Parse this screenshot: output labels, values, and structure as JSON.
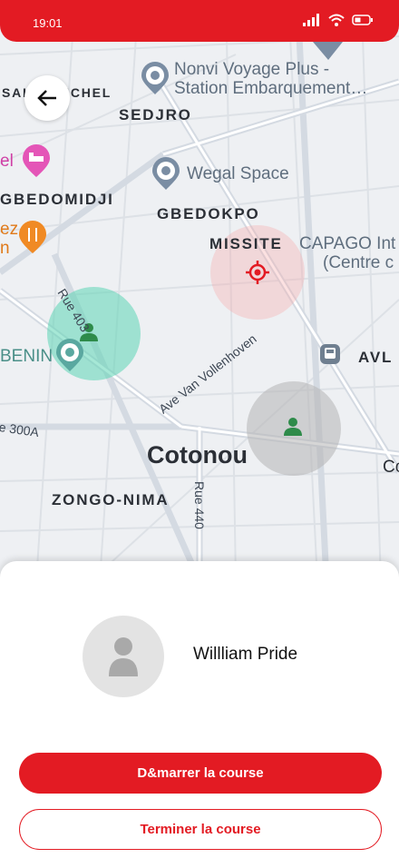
{
  "status_bar": {
    "time": "19:01"
  },
  "map": {
    "districts": [
      "SAINT-MICHEL",
      "SEDJRO",
      "GBEDOMIDJI",
      "GBEDOKPO",
      "MISSITE",
      "ZONGO-NIMA",
      "AVL"
    ],
    "pois": {
      "nonvi_line1": "Nonvi Voyage Plus -",
      "nonvi_line2": "Station Embarquement…",
      "wegal": "Wegal Space",
      "capago_line1": "CAPAGO Int",
      "capago_line2": "(Centre c",
      "hotel": "el",
      "restaurant_line1": "ez",
      "restaurant_line2": "n",
      "benin": "BENIN",
      "co": "Co"
    },
    "city": "Cotonou",
    "streets": [
      "Rue 403",
      "Ave Van Vollenhoven",
      "e 300A",
      "Rue 440"
    ]
  },
  "colors": {
    "accent": "#e31b23"
  },
  "driver": {
    "name": "Willliam Pride"
  },
  "actions": {
    "start_label": "D&marrer la course",
    "end_label": "Terminer la course"
  }
}
